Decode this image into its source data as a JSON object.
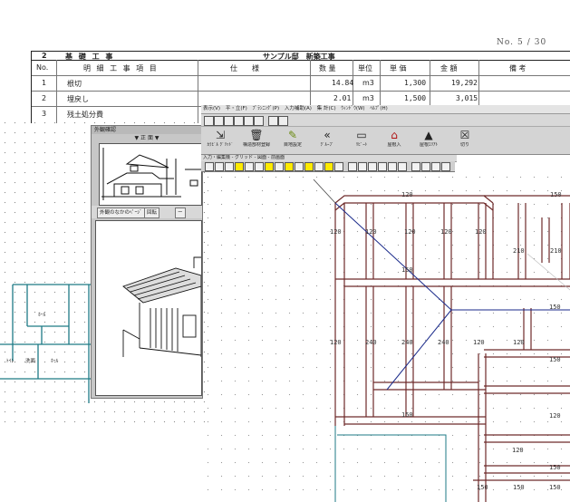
{
  "estimate": {
    "page_no": [
      "No.",
      "5",
      "/",
      "30"
    ],
    "section_no": "2",
    "section_title": "基 礎 工 事",
    "project_title": "サンプル邸　新築工事",
    "headers": [
      "No.",
      "明 細 工 事 項 目",
      "仕　　様",
      "数 量",
      "単位",
      "単 価",
      "金 額",
      "備 考"
    ],
    "rows": [
      {
        "no": "1",
        "item": "根切",
        "qty": "14.84",
        "unit": "m3",
        "price": "1,300",
        "amount": "19,292"
      },
      {
        "no": "2",
        "item": "埋戻し",
        "qty": "2.01",
        "unit": "m3",
        "price": "1,500",
        "amount": "3,015"
      },
      {
        "no": "3",
        "item": "残土処分費",
        "qty": "",
        "unit": "",
        "price": "",
        "amount": ""
      }
    ]
  },
  "cad": {
    "menu": [
      "表示(V)",
      "平・立(F)",
      "ﾌﾟﾗﾝﾆﾝｸﾞ(P)",
      "入力補助(A)",
      "集 計(C)",
      "ｳｨﾝﾄﾞｳ(W)",
      "ﾍﾙﾌﾟ(H)"
    ],
    "toolbar": [
      {
        "label": "ｶﾗﾋﾞﾙ ｸﾞﾘｯﾄﾞ",
        "icon": "grid-pointer-icon"
      },
      {
        "label": "構造部材登録",
        "icon": "trash-icon"
      },
      {
        "label": "目地設定",
        "icon": "pencil-icon"
      },
      {
        "label": "ｸﾞﾙｰﾌﾟ",
        "icon": "chevron-left-icon"
      },
      {
        "label": "ﾘﾋﾟｰﾄ",
        "icon": "box-icon"
      },
      {
        "label": "屋根入",
        "icon": "house-icon"
      },
      {
        "label": "屋根ｴﾘｱﾄ",
        "icon": "roof-icon"
      },
      {
        "label": "切り",
        "icon": "cut-icon"
      }
    ],
    "subtitle": "入力・編集機 - グリッド - 図面 - 前画面"
  },
  "viewer": {
    "title": "外観確認",
    "subtitle": "▼ 正 面 ▼",
    "buttons": [
      "外観のなかのﾍﾟｰｼﾞ",
      "回転",
      "ー"
    ]
  },
  "floorplan": {
    "room_label": "ﾎｰﾙ",
    "bottom_labels": [
      "ﾄｲﾚ",
      "洗面",
      "ﾎｰﾙ"
    ]
  },
  "beam_labels": {
    "top": [
      "120",
      "150"
    ],
    "row1": [
      "120",
      "120",
      "120",
      "120",
      "120",
      "210",
      "210"
    ],
    "mid": [
      "150"
    ],
    "row2": [
      "120",
      "240",
      "240",
      "240",
      "120",
      "120"
    ],
    "right": [
      "150",
      "150"
    ],
    "low": [
      "150",
      "120",
      "120"
    ],
    "bottom": [
      "150",
      "150",
      "150",
      "150"
    ]
  },
  "colors": {
    "beam": "#6e2a2a",
    "hip": "#1a2a8a",
    "teal": "#1d7a85",
    "grid_dot": "#9a9a9a"
  }
}
